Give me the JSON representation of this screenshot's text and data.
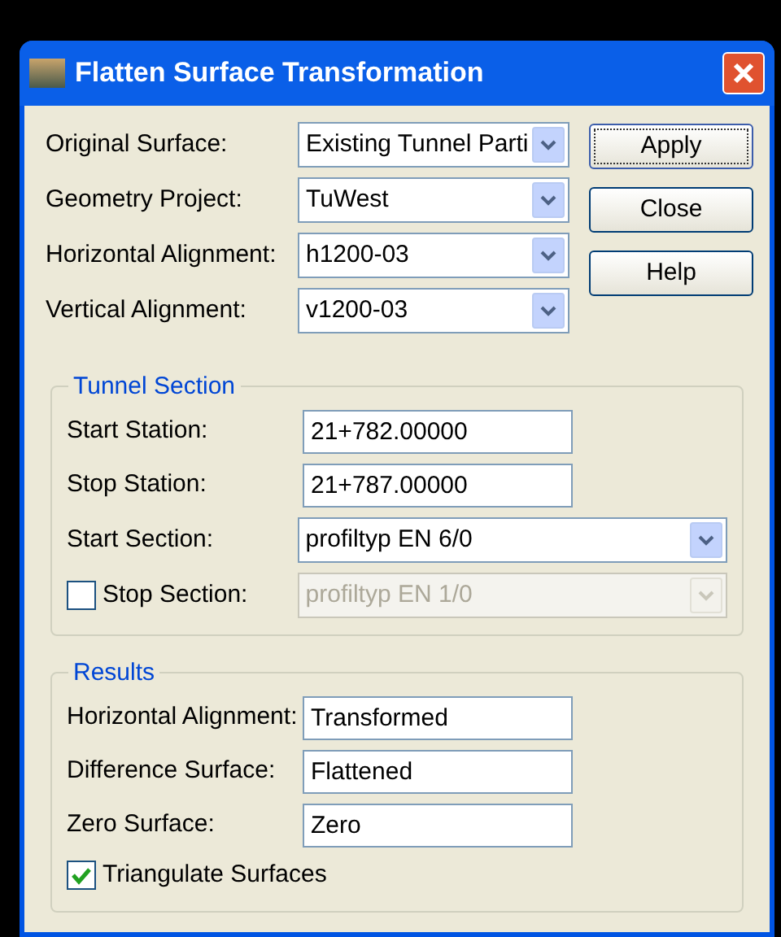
{
  "window": {
    "title": "Flatten Surface Transformation"
  },
  "top_fields": [
    {
      "label": "Original Surface:",
      "value": "Existing Tunnel Parti",
      "kind": "combo"
    },
    {
      "label": "Geometry Project:",
      "value": "TuWest",
      "kind": "combo"
    },
    {
      "label": "Horizontal Alignment:",
      "value": "h1200-03",
      "kind": "combo"
    },
    {
      "label": "Vertical Alignment:",
      "value": "v1200-03",
      "kind": "combo"
    }
  ],
  "buttons": [
    {
      "label": "Apply",
      "default": true
    },
    {
      "label": "Close",
      "default": false
    },
    {
      "label": "Help",
      "default": false
    }
  ],
  "tunnel_section": {
    "title": "Tunnel Section",
    "rows": [
      {
        "label": "Start Station:",
        "value": "21+782.00000",
        "kind": "text"
      },
      {
        "label": "Stop Station:",
        "value": "21+787.00000",
        "kind": "text"
      },
      {
        "label": "Start Section:",
        "value": "profiltyp EN 6/0",
        "kind": "combo",
        "disabled": false
      },
      {
        "label": "Stop Section:",
        "value": "profiltyp EN 1/0",
        "kind": "check-combo",
        "checked": false,
        "disabled": true
      }
    ]
  },
  "results": {
    "title": "Results",
    "rows": [
      {
        "label": "Horizontal Alignment:",
        "value": "Transformed",
        "kind": "text"
      },
      {
        "label": "Difference Surface:",
        "value": "Flattened",
        "kind": "text"
      },
      {
        "label": "Zero Surface:",
        "value": "Zero",
        "kind": "text"
      }
    ],
    "checkbox": {
      "label": "Triangulate Surfaces",
      "checked": true
    }
  }
}
